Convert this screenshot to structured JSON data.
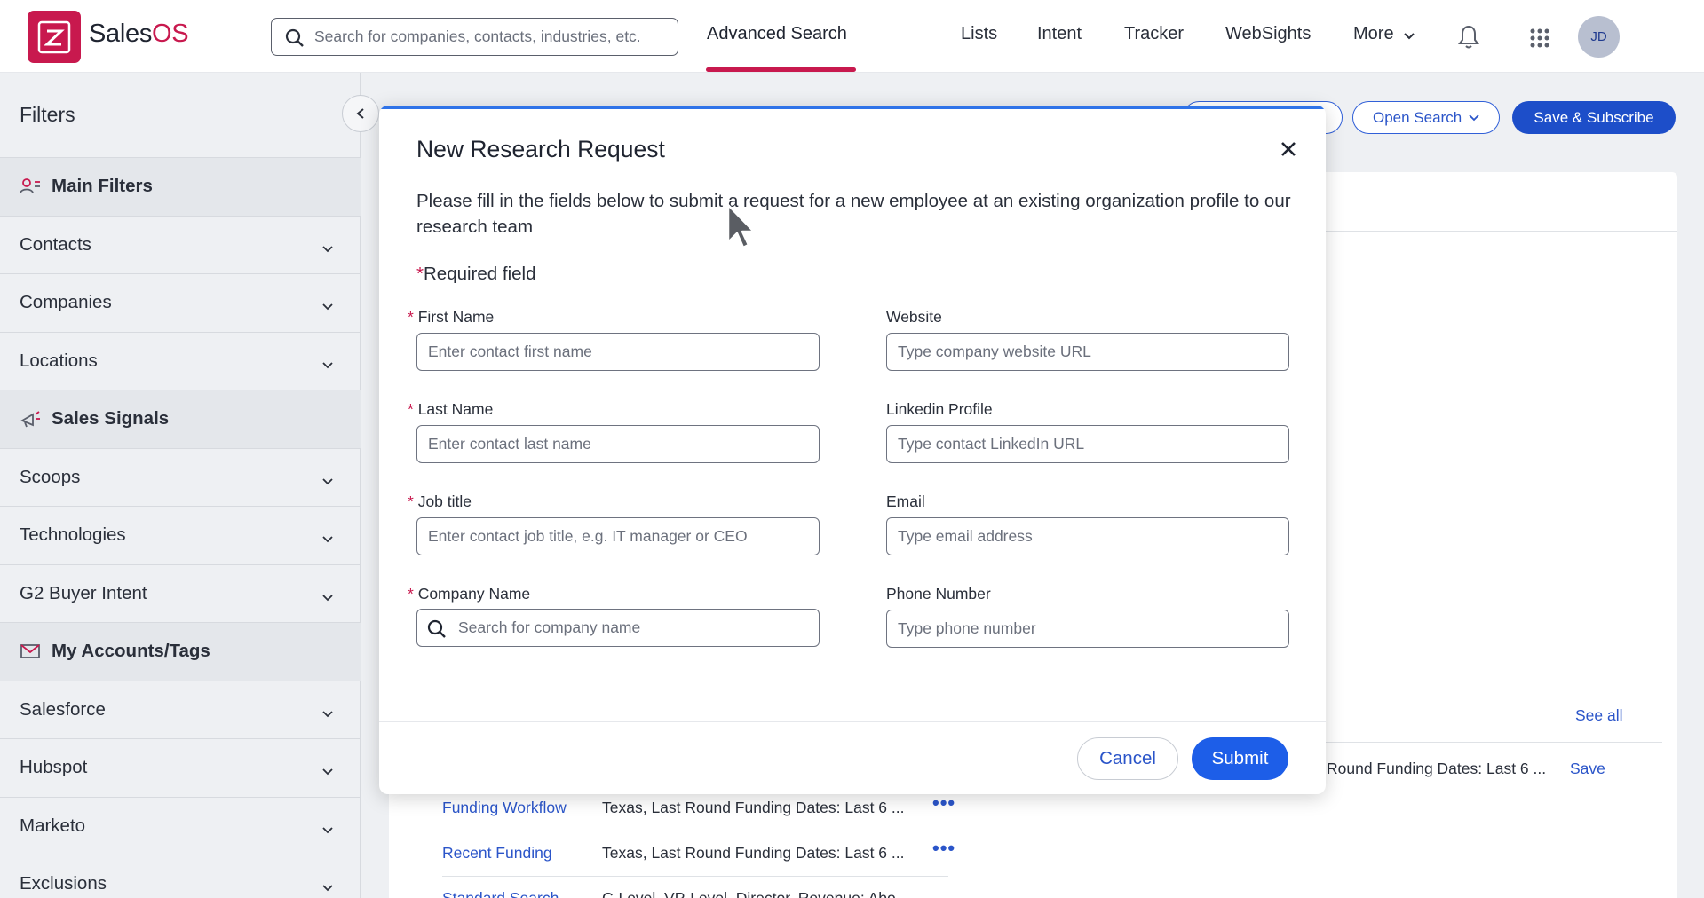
{
  "header": {
    "brand": "Sales",
    "brand_accent": "OS",
    "search_placeholder": "Search for companies, contacts, industries, etc.",
    "nav": [
      "Advanced Search",
      "Lists",
      "Intent",
      "Tracker",
      "WebSights",
      "More"
    ],
    "avatar_initials": "JD"
  },
  "sidebar": {
    "title": "Filters",
    "items": [
      {
        "label": "Main Filters",
        "type": "section",
        "icon": "contacts-icon"
      },
      {
        "label": "Contacts",
        "type": "expand"
      },
      {
        "label": "Companies",
        "type": "expand"
      },
      {
        "label": "Locations",
        "type": "expand"
      },
      {
        "label": "Sales Signals",
        "type": "section",
        "icon": "megaphone-icon"
      },
      {
        "label": "Scoops",
        "type": "expand"
      },
      {
        "label": "Technologies",
        "type": "expand"
      },
      {
        "label": "G2 Buyer Intent",
        "type": "expand"
      },
      {
        "label": "My Accounts/Tags",
        "type": "section",
        "icon": "mail-tag-icon"
      },
      {
        "label": "Salesforce",
        "type": "expand"
      },
      {
        "label": "Hubspot",
        "type": "expand"
      },
      {
        "label": "Marketo",
        "type": "expand"
      },
      {
        "label": "Exclusions",
        "type": "expand"
      }
    ]
  },
  "toolbar": {
    "open_search": "Open Search",
    "save_subscribe": "Save & Subscribe"
  },
  "background": {
    "see_all": "See all",
    "save": "Save",
    "right_row_text": "Round Funding Dates: Last 6 ...",
    "rows": [
      {
        "name": "Funding Workflow",
        "criteria": "Texas, Last Round Funding Dates: Last 6 ..."
      },
      {
        "name": "Recent Funding",
        "criteria": "Texas, Last Round Funding Dates: Last 6 ..."
      },
      {
        "name": "Standard Search",
        "criteria": "C-Level, VP-Level, Director, Revenue: Abo..."
      }
    ]
  },
  "modal": {
    "title": "New Research Request",
    "description": "Please fill in the fields below to submit a request for a new employee at an existing organization profile to our research team",
    "required_note": "Required field",
    "fields": {
      "first_name": {
        "label": "First Name",
        "placeholder": "Enter contact first name"
      },
      "last_name": {
        "label": "Last Name",
        "placeholder": "Enter contact last name"
      },
      "job_title": {
        "label": "Job title",
        "placeholder": "Enter contact job title, e.g. IT manager or CEO"
      },
      "company_name": {
        "label": "Company Name",
        "placeholder": "Search for company name"
      },
      "website": {
        "label": "Website",
        "placeholder": "Type company website URL"
      },
      "linkedin": {
        "label": "Linkedin Profile",
        "placeholder": "Type contact LinkedIn URL"
      },
      "email": {
        "label": "Email",
        "placeholder": "Type email address"
      },
      "phone": {
        "label": "Phone Number",
        "placeholder": "Type phone number"
      }
    },
    "cancel": "Cancel",
    "submit": "Submit"
  },
  "colors": {
    "brand": "#c8194e",
    "primary": "#1d5ee8",
    "link": "#2b55c9"
  }
}
